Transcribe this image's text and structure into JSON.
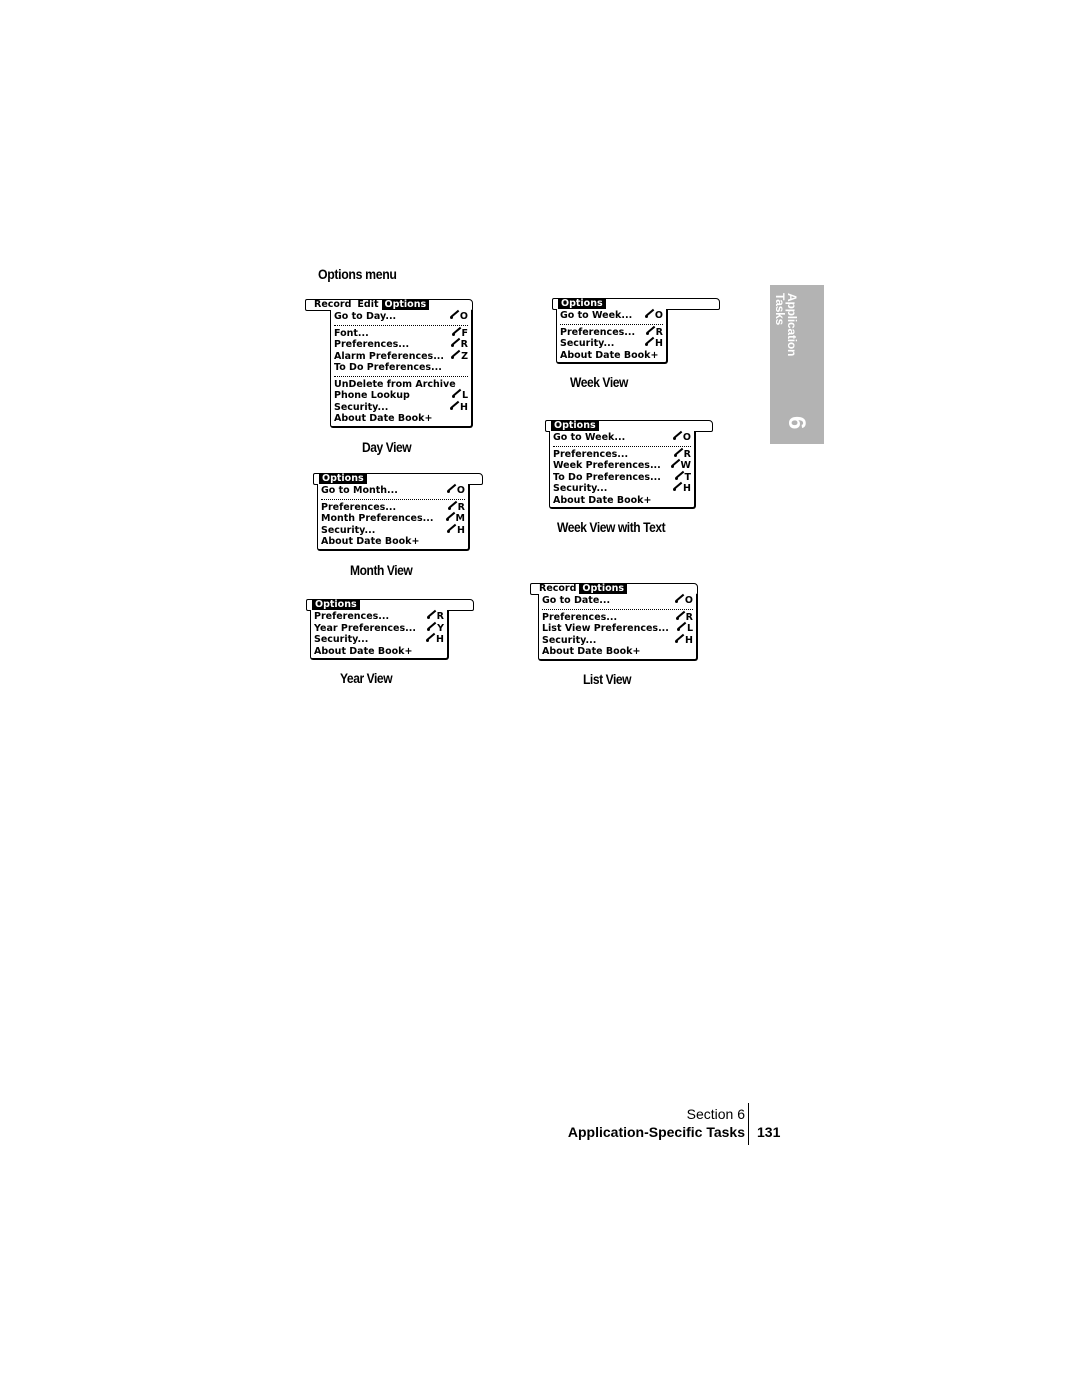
{
  "heading": "Options menu",
  "menus": {
    "day": {
      "caption": "Day View",
      "menubar": [
        "Record",
        "Edit",
        "Options"
      ],
      "active": "Options",
      "groups": [
        [
          {
            "label": "Go to Day...",
            "shortcut": "O"
          }
        ],
        [
          {
            "label": "Font...",
            "shortcut": "F"
          },
          {
            "label": "Preferences...",
            "shortcut": "R"
          },
          {
            "label": "Alarm Preferences...",
            "shortcut": "Z"
          },
          {
            "label": "To Do Preferences...",
            "shortcut": ""
          }
        ],
        [
          {
            "label": "UnDelete from Archive",
            "shortcut": ""
          },
          {
            "label": "Phone Lookup",
            "shortcut": "L"
          },
          {
            "label": "Security...",
            "shortcut": "H"
          },
          {
            "label": "About Date Book+",
            "shortcut": ""
          }
        ]
      ]
    },
    "month": {
      "caption": "Month View",
      "menubar": [
        "Options"
      ],
      "active": "Options",
      "groups": [
        [
          {
            "label": "Go to Month...",
            "shortcut": "O"
          }
        ],
        [
          {
            "label": "Preferences...",
            "shortcut": "R"
          },
          {
            "label": "Month Preferences...",
            "shortcut": "M"
          },
          {
            "label": "Security...",
            "shortcut": "H"
          },
          {
            "label": "About Date Book+",
            "shortcut": ""
          }
        ]
      ]
    },
    "year": {
      "caption": "Year View",
      "menubar": [
        "Options"
      ],
      "active": "Options",
      "groups": [
        [
          {
            "label": "Preferences...",
            "shortcut": "R"
          },
          {
            "label": "Year Preferences...",
            "shortcut": "Y"
          },
          {
            "label": "Security...",
            "shortcut": "H"
          },
          {
            "label": "About Date Book+",
            "shortcut": ""
          }
        ]
      ]
    },
    "week": {
      "caption": "Week View",
      "menubar": [
        "Options"
      ],
      "active": "Options",
      "groups": [
        [
          {
            "label": "Go to Week...",
            "shortcut": "O"
          }
        ],
        [
          {
            "label": "Preferences...",
            "shortcut": "R"
          },
          {
            "label": "Security...",
            "shortcut": "H"
          },
          {
            "label": "About Date Book+",
            "shortcut": ""
          }
        ]
      ]
    },
    "weektext": {
      "caption": "Week View with Text",
      "menubar": [
        "Options"
      ],
      "active": "Options",
      "groups": [
        [
          {
            "label": "Go to Week...",
            "shortcut": "O"
          }
        ],
        [
          {
            "label": "Preferences...",
            "shortcut": "R"
          },
          {
            "label": "Week Preferences...",
            "shortcut": "W"
          },
          {
            "label": "To Do Preferences...",
            "shortcut": "T"
          },
          {
            "label": "Security...",
            "shortcut": "H"
          },
          {
            "label": "About Date Book+",
            "shortcut": ""
          }
        ]
      ]
    },
    "list": {
      "caption": "List View",
      "menubar": [
        "Record",
        "Options"
      ],
      "active": "Options",
      "groups": [
        [
          {
            "label": "Go to Date...",
            "shortcut": "O"
          }
        ],
        [
          {
            "label": "Preferences...",
            "shortcut": "R"
          },
          {
            "label": "List View Preferences...",
            "shortcut": "L"
          },
          {
            "label": "Security...",
            "shortcut": "H"
          },
          {
            "label": "About Date Book+",
            "shortcut": ""
          }
        ]
      ]
    }
  },
  "sidetab": {
    "line1": "Application",
    "line2": "Tasks",
    "number": "6",
    "color": "#b3b3b3"
  },
  "footer": {
    "section": "Section 6",
    "title": "Application-Specific Tasks",
    "page": "131"
  }
}
